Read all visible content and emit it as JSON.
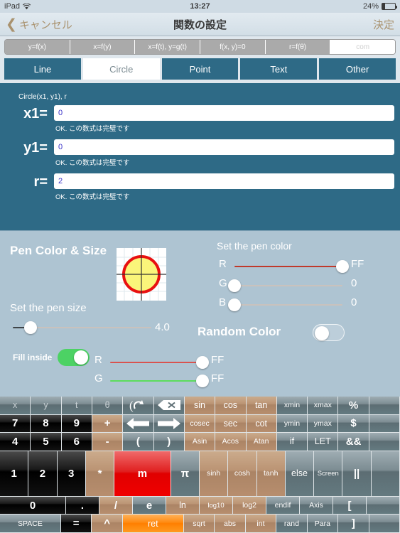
{
  "status_bar": {
    "device": "iPad",
    "wifi_icon": "wifi-icon",
    "time": "13:27",
    "battery_percent": "24%",
    "battery_icon": "battery-icon"
  },
  "nav_bar": {
    "back_icon": "chevron-left-icon",
    "back_label": "キャンセル",
    "title": "関数の設定",
    "done_label": "決定"
  },
  "function_type_tabs": {
    "items": [
      {
        "label": "y=f(x)",
        "selected": false
      },
      {
        "label": "x=f(y)",
        "selected": false
      },
      {
        "label": "x=f(t), y=g(t)",
        "selected": false
      },
      {
        "label": "f(x, y)=0",
        "selected": false
      },
      {
        "label": "r=f(θ)",
        "selected": false
      },
      {
        "label": "com",
        "selected": true
      }
    ]
  },
  "object_tabs": {
    "items": [
      {
        "label": "Line",
        "selected": false
      },
      {
        "label": "Circle",
        "selected": true
      },
      {
        "label": "Point",
        "selected": false
      },
      {
        "label": "Text",
        "selected": false
      },
      {
        "label": "Other",
        "selected": false
      }
    ]
  },
  "form": {
    "caption": "Circle(x1, y1), r",
    "accent_color": "#2e6a86",
    "fields": [
      {
        "label": "x1=",
        "value": "0",
        "status": "OK. この数式は完璧です"
      },
      {
        "label": "y1=",
        "value": "0",
        "status": "OK. この数式は完璧です"
      },
      {
        "label": "r=",
        "value": "2",
        "status": "OK. この数式は完璧です"
      }
    ]
  },
  "pen_panel": {
    "title": "Pen Color & Size",
    "pen_size_label": "Set the pen size",
    "pen_size_value": "4.0",
    "pen_size_percent": 13,
    "pen_color_label": "Set the pen color",
    "random_color_label": "Random Color",
    "random_color_on": false,
    "fill_inside_label": "Fill inside",
    "fill_inside_on": true,
    "preview_icon": "circle-preview-icon",
    "preview_stroke": "#e81010",
    "preview_fill": "#faf57a",
    "pen_color_sliders": [
      {
        "channel": "R",
        "value": "FF",
        "percent": 100,
        "color": "#c0392b"
      },
      {
        "channel": "G",
        "value": "0",
        "percent": 0,
        "color": "#2ecc40"
      },
      {
        "channel": "B",
        "value": "0",
        "percent": 0,
        "color": "#3498db"
      }
    ],
    "fill_color_sliders": [
      {
        "channel": "R",
        "value": "FF",
        "percent": 100,
        "color": "#d9534f"
      },
      {
        "channel": "G",
        "value": "FF",
        "percent": 100,
        "color": "#5cdd5c"
      }
    ]
  },
  "keyboard": {
    "rows": [
      [
        {
          "label": "x",
          "style": "gray dim"
        },
        {
          "label": "y",
          "style": "gray dim"
        },
        {
          "label": "t",
          "style": "gray dim"
        },
        {
          "label": "θ",
          "style": "gray dim"
        },
        {
          "label": "",
          "style": "gray",
          "icon": "undo-icon"
        },
        {
          "label": "",
          "style": "gray",
          "icon": "backspace-icon"
        },
        {
          "label": "sin",
          "style": "tan"
        },
        {
          "label": "cos",
          "style": "tan"
        },
        {
          "label": "tan",
          "style": "tan"
        },
        {
          "label": "xmin",
          "style": "gray small"
        },
        {
          "label": "xmax",
          "style": "gray small"
        },
        {
          "label": "%",
          "style": "gray big"
        },
        {
          "label": "",
          "style": "gray"
        }
      ],
      [
        {
          "label": "7",
          "style": "black big"
        },
        {
          "label": "8",
          "style": "black big"
        },
        {
          "label": "9",
          "style": "black big"
        },
        {
          "label": "+",
          "style": "tan big"
        },
        {
          "label": "",
          "style": "gray",
          "icon": "arrow-left-icon"
        },
        {
          "label": "",
          "style": "gray",
          "icon": "arrow-right-icon"
        },
        {
          "label": "cosec",
          "style": "tan small"
        },
        {
          "label": "sec",
          "style": "tan"
        },
        {
          "label": "cot",
          "style": "tan"
        },
        {
          "label": "ymin",
          "style": "gray small"
        },
        {
          "label": "ymax",
          "style": "gray small"
        },
        {
          "label": "$",
          "style": "gray big"
        },
        {
          "label": "",
          "style": "gray"
        }
      ],
      [
        {
          "label": "4",
          "style": "black big"
        },
        {
          "label": "5",
          "style": "black big"
        },
        {
          "label": "6",
          "style": "black big"
        },
        {
          "label": "-",
          "style": "tan big"
        },
        {
          "label": "(",
          "style": "gray big"
        },
        {
          "label": ")",
          "style": "gray big"
        },
        {
          "label": "Asin",
          "style": "tan small"
        },
        {
          "label": "Acos",
          "style": "tan small"
        },
        {
          "label": "Atan",
          "style": "tan small"
        },
        {
          "label": "if",
          "style": "gray"
        },
        {
          "label": "LET",
          "style": "gray"
        },
        {
          "label": "&&",
          "style": "gray big"
        },
        {
          "label": "",
          "style": "gray"
        }
      ],
      [
        {
          "label": "1",
          "style": "black big"
        },
        {
          "label": "2",
          "style": "black big"
        },
        {
          "label": "3",
          "style": "black big"
        },
        {
          "label": "*",
          "style": "tan big"
        },
        {
          "label": "m",
          "style": "red big",
          "rowspan": 2,
          "width": 2
        },
        {
          "label": "π",
          "style": "gray big"
        },
        {
          "label": "sinh",
          "style": "tan small"
        },
        {
          "label": "cosh",
          "style": "tan small"
        },
        {
          "label": "tanh",
          "style": "tan small"
        },
        {
          "label": "else",
          "style": "gray"
        },
        {
          "label": "Screen",
          "style": "gray xsmall"
        },
        {
          "label": "||",
          "style": "gray big"
        },
        {
          "label": "",
          "style": "gray"
        }
      ],
      [
        {
          "label": "0",
          "style": "black big",
          "width": 2
        },
        {
          "label": ".",
          "style": "black big"
        },
        {
          "label": "/",
          "style": "tan big"
        },
        {
          "label": "e",
          "style": "gray big"
        },
        {
          "label": "ln",
          "style": "tan"
        },
        {
          "label": "log10",
          "style": "tan xsmall"
        },
        {
          "label": "log2",
          "style": "tan small"
        },
        {
          "label": "endif",
          "style": "gray small"
        },
        {
          "label": "Axis",
          "style": "gray small"
        },
        {
          "label": "[",
          "style": "gray big"
        },
        {
          "label": "",
          "style": "gray"
        }
      ],
      [
        {
          "label": "SPACE",
          "style": "gray small",
          "width": 2
        },
        {
          "label": "=",
          "style": "black big"
        },
        {
          "label": "^",
          "style": "tan big"
        },
        {
          "label": "ret",
          "style": "orange",
          "width": 2
        },
        {
          "label": "sqrt",
          "style": "tan small"
        },
        {
          "label": "abs",
          "style": "tan small"
        },
        {
          "label": "int",
          "style": "tan small"
        },
        {
          "label": "rand",
          "style": "gray small"
        },
        {
          "label": "Para",
          "style": "gray small"
        },
        {
          "label": "]",
          "style": "gray big"
        },
        {
          "label": "",
          "style": "gray"
        }
      ]
    ]
  }
}
